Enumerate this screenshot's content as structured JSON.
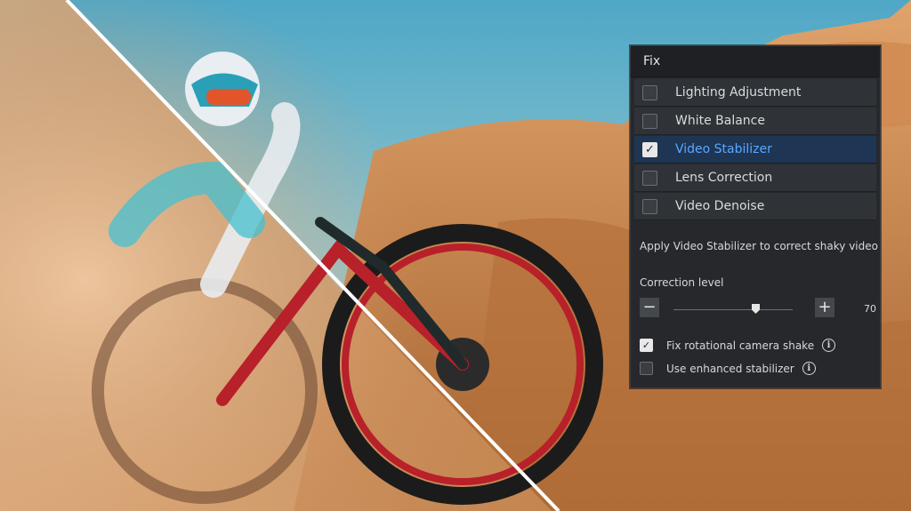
{
  "panel": {
    "title": "Fix",
    "items": [
      {
        "label": "Lighting Adjustment",
        "checked": false
      },
      {
        "label": "White Balance",
        "checked": false
      },
      {
        "label": "Video Stabilizer",
        "checked": true
      },
      {
        "label": "Lens Correction",
        "checked": false
      },
      {
        "label": "Video Denoise",
        "checked": false
      }
    ],
    "description": "Apply Video Stabilizer to correct shaky video",
    "correction_label": "Correction level",
    "correction_value": "70",
    "minus": "−",
    "plus": "+",
    "options": [
      {
        "label": "Fix rotational camera shake",
        "checked": true
      },
      {
        "label": "Use enhanced stabilizer",
        "checked": false
      }
    ],
    "info_icon": "i",
    "checkmark": "✓"
  },
  "colors": {
    "accent": "#5aa8ff",
    "selected_row": "#1e3553",
    "panel_bg": "#26282c"
  }
}
